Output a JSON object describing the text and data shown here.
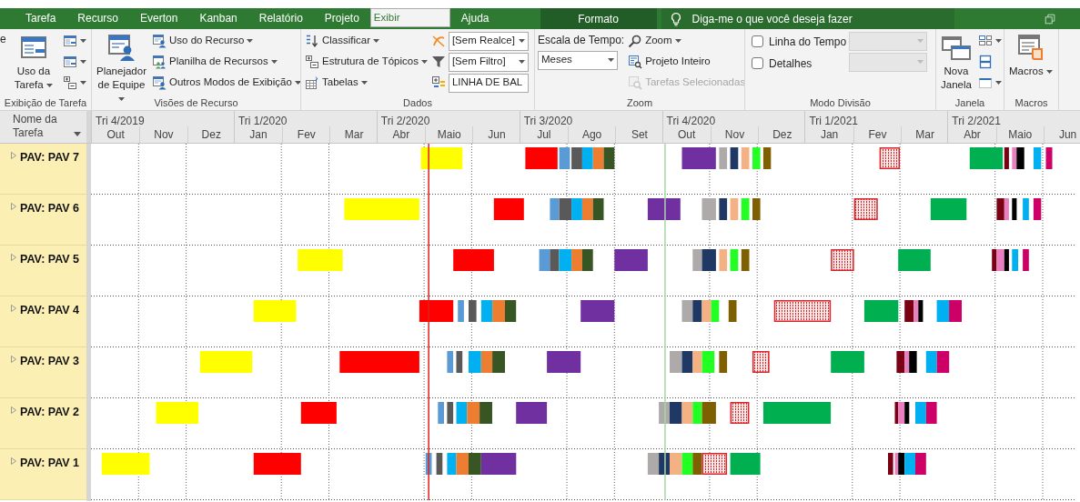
{
  "tabs": [
    {
      "label": "Tarefa",
      "selected": false
    },
    {
      "label": "Recurso",
      "selected": false
    },
    {
      "label": "Everton",
      "selected": false
    },
    {
      "label": "Kanban",
      "selected": false
    },
    {
      "label": "Relatório",
      "selected": false
    },
    {
      "label": "Projeto",
      "selected": false
    },
    {
      "label": "Exibir",
      "selected": true
    },
    {
      "label": "Ajuda",
      "selected": false
    }
  ],
  "context_tab": {
    "label": "Formato"
  },
  "search": {
    "placeholder": "Diga-me o que você deseja fazer"
  },
  "ribbon": {
    "groups": [
      {
        "label": "Exibição de Tarefa",
        "columns": [
          [
            {
              "kind": "cut",
              "label": "e"
            }
          ],
          [
            {
              "kind": "large",
              "label": "Uso da Tarefa",
              "caret": true
            }
          ],
          [
            {
              "kind": "icon",
              "caret": true
            },
            {
              "kind": "icon",
              "caret": true
            },
            {
              "kind": "icon",
              "caret": true
            }
          ]
        ]
      },
      {
        "label": "Visões de Recurso",
        "columns": [
          [
            {
              "kind": "large",
              "label": "Planejador de Equipe",
              "caret": true
            }
          ],
          [
            {
              "kind": "small",
              "label": "Uso do Recurso",
              "caret": true,
              "disabled": false
            },
            {
              "kind": "small",
              "label": "Planilha de Recursos",
              "caret": true,
              "disabled": false
            },
            {
              "kind": "small",
              "label": "Outros Modos de Exibição",
              "caret": true,
              "disabled": false
            }
          ]
        ]
      },
      {
        "label": "Dados",
        "columns": [
          [
            {
              "kind": "small",
              "label": "Classificar",
              "caret": true,
              "disabled": false
            },
            {
              "kind": "small",
              "label": "Estrutura de Tópicos",
              "caret": true,
              "disabled": false
            },
            {
              "kind": "small",
              "label": "Tabelas",
              "caret": true,
              "disabled": false
            }
          ],
          [
            {
              "kind": "icon-select",
              "value": "[Sem Realce]",
              "disabled": false
            },
            {
              "kind": "icon-select",
              "value": "[Sem Filtro]",
              "disabled": false
            },
            {
              "kind": "icon-select",
              "value": "LINHA DE BAL",
              "disabled": false
            }
          ]
        ]
      },
      {
        "label": "Zoom",
        "columns": [
          [
            {
              "kind": "caption",
              "label": "Escala de Tempo:"
            },
            {
              "kind": "select",
              "value": "Meses",
              "disabled": false
            }
          ],
          [
            {
              "kind": "small",
              "label": "Zoom",
              "caret": true,
              "disabled": false
            },
            {
              "kind": "small",
              "label": "Projeto Inteiro",
              "caret": false,
              "disabled": false
            },
            {
              "kind": "small",
              "label": "Tarefas Selecionadas",
              "caret": false,
              "disabled": true
            }
          ]
        ]
      },
      {
        "label": "Modo Divisão",
        "columns": [
          [
            {
              "kind": "checkbox",
              "label": "Linha do Tempo",
              "checked": false
            },
            {
              "kind": "checkbox",
              "label": "Detalhes",
              "checked": false
            }
          ],
          [
            {
              "kind": "select",
              "disabled": true
            },
            {
              "kind": "select",
              "disabled": true
            }
          ]
        ]
      },
      {
        "label": "Janela",
        "columns": [
          [
            {
              "kind": "large",
              "label": "Nova Janela",
              "caret": false
            }
          ],
          [
            {
              "kind": "icon",
              "caret": true
            },
            {
              "kind": "icon",
              "caret": false
            },
            {
              "kind": "icon",
              "caret": true
            }
          ]
        ]
      },
      {
        "label": "Macros",
        "columns": [
          [
            {
              "kind": "large",
              "label": "Macros",
              "caret": true
            }
          ]
        ]
      }
    ]
  },
  "task_column": {
    "header": "Nome da Tarefa"
  },
  "timescale": {
    "quarters": [
      {
        "label": "Tri 4/2019",
        "months": [
          "Out",
          "Nov",
          "Dez"
        ]
      },
      {
        "label": "Tri 1/2020",
        "months": [
          "Jan",
          "Fev",
          "Mar"
        ]
      },
      {
        "label": "Tri 2/2020",
        "months": [
          "Abr",
          "Maio",
          "Jun"
        ]
      },
      {
        "label": "Tri 3/2020",
        "months": [
          "Jul",
          "Ago",
          "Set"
        ]
      },
      {
        "label": "Tri 4/2020",
        "months": [
          "Out",
          "Nov",
          "Dez"
        ]
      },
      {
        "label": "Tri 1/2021",
        "months": [
          "Jan",
          "Fev",
          "Mar"
        ]
      },
      {
        "label": "Tri 2/2021",
        "months": [
          "Abr",
          "Maio",
          "Jun"
        ]
      }
    ]
  },
  "date_lines": [
    {
      "color": "#e0201c"
    },
    {
      "color": "#a8d4a8"
    }
  ],
  "tasks": [
    {
      "name": "PAV: PAV 7",
      "expanded": false,
      "bars": [
        {
          "color": "#ffff00",
          "kind": "solid"
        },
        {
          "color": "#ff0000",
          "kind": "solid"
        },
        {
          "color": "#5b9bd5",
          "kind": "solid"
        },
        {
          "color": "#595959",
          "kind": "solid"
        },
        {
          "color": "#00b0f0",
          "kind": "solid"
        },
        {
          "color": "#ed7d31",
          "kind": "solid"
        },
        {
          "color": "#375623",
          "kind": "solid"
        },
        {
          "color": "#7030a0",
          "kind": "solid"
        },
        {
          "color": "#aeaaaa",
          "kind": "solid"
        },
        {
          "color": "#203864",
          "kind": "solid"
        },
        {
          "color": "#f4b183",
          "kind": "solid"
        },
        {
          "color": "#22ff22",
          "kind": "solid"
        },
        {
          "color": "#7f6000",
          "kind": "solid"
        },
        {
          "color": "#d9262c",
          "kind": "hatched"
        },
        {
          "color": "#00b050",
          "kind": "solid"
        },
        {
          "color": "#7a0013",
          "kind": "solid"
        },
        {
          "color": "#e880c0",
          "kind": "solid"
        },
        {
          "color": "#000000",
          "kind": "solid"
        },
        {
          "color": "#00b0f0",
          "kind": "solid"
        },
        {
          "color": "#cc0066",
          "kind": "solid"
        }
      ]
    },
    {
      "name": "PAV: PAV 6",
      "expanded": false,
      "bars": [
        {
          "color": "#ffff00",
          "kind": "solid"
        },
        {
          "color": "#ff0000",
          "kind": "solid"
        },
        {
          "color": "#5b9bd5",
          "kind": "solid"
        },
        {
          "color": "#595959",
          "kind": "solid"
        },
        {
          "color": "#00b0f0",
          "kind": "solid"
        },
        {
          "color": "#ed7d31",
          "kind": "solid"
        },
        {
          "color": "#375623",
          "kind": "solid"
        },
        {
          "color": "#7030a0",
          "kind": "solid"
        },
        {
          "color": "#aeaaaa",
          "kind": "solid"
        },
        {
          "color": "#203864",
          "kind": "solid"
        },
        {
          "color": "#f4b183",
          "kind": "solid"
        },
        {
          "color": "#22ff22",
          "kind": "solid"
        },
        {
          "color": "#7f6000",
          "kind": "solid"
        },
        {
          "color": "#d9262c",
          "kind": "hatched"
        },
        {
          "color": "#00b050",
          "kind": "solid"
        },
        {
          "color": "#7a0013",
          "kind": "solid"
        },
        {
          "color": "#e880c0",
          "kind": "solid"
        },
        {
          "color": "#000000",
          "kind": "solid"
        },
        {
          "color": "#00b0f0",
          "kind": "solid"
        },
        {
          "color": "#cc0066",
          "kind": "solid"
        }
      ]
    },
    {
      "name": "PAV: PAV 5",
      "expanded": false,
      "bars": [
        {
          "color": "#ffff00",
          "kind": "solid"
        },
        {
          "color": "#ff0000",
          "kind": "solid"
        },
        {
          "color": "#5b9bd5",
          "kind": "solid"
        },
        {
          "color": "#595959",
          "kind": "solid"
        },
        {
          "color": "#00b0f0",
          "kind": "solid"
        },
        {
          "color": "#ed7d31",
          "kind": "solid"
        },
        {
          "color": "#375623",
          "kind": "solid"
        },
        {
          "color": "#7030a0",
          "kind": "solid"
        },
        {
          "color": "#aeaaaa",
          "kind": "solid"
        },
        {
          "color": "#203864",
          "kind": "solid"
        },
        {
          "color": "#f4b183",
          "kind": "solid"
        },
        {
          "color": "#22ff22",
          "kind": "solid"
        },
        {
          "color": "#7f6000",
          "kind": "solid"
        },
        {
          "color": "#d9262c",
          "kind": "hatched"
        },
        {
          "color": "#00b050",
          "kind": "solid"
        },
        {
          "color": "#7a0013",
          "kind": "solid"
        },
        {
          "color": "#e880c0",
          "kind": "solid"
        },
        {
          "color": "#000000",
          "kind": "solid"
        },
        {
          "color": "#00b0f0",
          "kind": "solid"
        },
        {
          "color": "#cc0066",
          "kind": "solid"
        }
      ]
    },
    {
      "name": "PAV: PAV 4",
      "expanded": false,
      "bars": [
        {
          "color": "#ffff00",
          "kind": "solid"
        },
        {
          "color": "#ff0000",
          "kind": "solid"
        },
        {
          "color": "#5b9bd5",
          "kind": "solid"
        },
        {
          "color": "#595959",
          "kind": "solid"
        },
        {
          "color": "#00b0f0",
          "kind": "solid"
        },
        {
          "color": "#ed7d31",
          "kind": "solid"
        },
        {
          "color": "#375623",
          "kind": "solid"
        },
        {
          "color": "#7030a0",
          "kind": "solid"
        },
        {
          "color": "#aeaaaa",
          "kind": "solid"
        },
        {
          "color": "#203864",
          "kind": "solid"
        },
        {
          "color": "#f4b183",
          "kind": "solid"
        },
        {
          "color": "#22ff22",
          "kind": "solid"
        },
        {
          "color": "#7f6000",
          "kind": "solid"
        },
        {
          "color": "#d9262c",
          "kind": "hatched"
        },
        {
          "color": "#00b050",
          "kind": "solid"
        },
        {
          "color": "#7a0013",
          "kind": "solid"
        },
        {
          "color": "#e880c0",
          "kind": "solid"
        },
        {
          "color": "#000000",
          "kind": "solid"
        },
        {
          "color": "#00b0f0",
          "kind": "solid"
        },
        {
          "color": "#cc0066",
          "kind": "solid"
        }
      ]
    },
    {
      "name": "PAV: PAV 3",
      "expanded": false,
      "bars": [
        {
          "color": "#ffff00",
          "kind": "solid"
        },
        {
          "color": "#ff0000",
          "kind": "solid"
        },
        {
          "color": "#5b9bd5",
          "kind": "solid"
        },
        {
          "color": "#595959",
          "kind": "solid"
        },
        {
          "color": "#00b0f0",
          "kind": "solid"
        },
        {
          "color": "#ed7d31",
          "kind": "solid"
        },
        {
          "color": "#375623",
          "kind": "solid"
        },
        {
          "color": "#7030a0",
          "kind": "solid"
        },
        {
          "color": "#aeaaaa",
          "kind": "solid"
        },
        {
          "color": "#203864",
          "kind": "solid"
        },
        {
          "color": "#f4b183",
          "kind": "solid"
        },
        {
          "color": "#22ff22",
          "kind": "solid"
        },
        {
          "color": "#7f6000",
          "kind": "solid"
        },
        {
          "color": "#d9262c",
          "kind": "hatched"
        },
        {
          "color": "#00b050",
          "kind": "solid"
        },
        {
          "color": "#7a0013",
          "kind": "solid"
        },
        {
          "color": "#e880c0",
          "kind": "solid"
        },
        {
          "color": "#000000",
          "kind": "solid"
        },
        {
          "color": "#00b0f0",
          "kind": "solid"
        },
        {
          "color": "#cc0066",
          "kind": "solid"
        }
      ]
    },
    {
      "name": "PAV: PAV 2",
      "expanded": false,
      "bars": [
        {
          "color": "#ffff00",
          "kind": "solid"
        },
        {
          "color": "#ff0000",
          "kind": "solid"
        },
        {
          "color": "#5b9bd5",
          "kind": "solid"
        },
        {
          "color": "#595959",
          "kind": "solid"
        },
        {
          "color": "#00b0f0",
          "kind": "solid"
        },
        {
          "color": "#ed7d31",
          "kind": "solid"
        },
        {
          "color": "#375623",
          "kind": "solid"
        },
        {
          "color": "#7030a0",
          "kind": "solid"
        },
        {
          "color": "#aeaaaa",
          "kind": "solid"
        },
        {
          "color": "#203864",
          "kind": "solid"
        },
        {
          "color": "#f4b183",
          "kind": "solid"
        },
        {
          "color": "#22ff22",
          "kind": "solid"
        },
        {
          "color": "#7f6000",
          "kind": "solid"
        },
        {
          "color": "#d9262c",
          "kind": "hatched"
        },
        {
          "color": "#00b050",
          "kind": "solid"
        },
        {
          "color": "#7a0013",
          "kind": "solid"
        },
        {
          "color": "#e880c0",
          "kind": "solid"
        },
        {
          "color": "#000000",
          "kind": "solid"
        },
        {
          "color": "#00b0f0",
          "kind": "solid"
        },
        {
          "color": "#cc0066",
          "kind": "solid"
        }
      ]
    },
    {
      "name": "PAV: PAV 1",
      "expanded": false,
      "bars": [
        {
          "color": "#ffff00",
          "kind": "solid"
        },
        {
          "color": "#ff0000",
          "kind": "solid"
        },
        {
          "color": "#5b9bd5",
          "kind": "solid"
        },
        {
          "color": "#595959",
          "kind": "solid"
        },
        {
          "color": "#00b0f0",
          "kind": "solid"
        },
        {
          "color": "#ed7d31",
          "kind": "solid"
        },
        {
          "color": "#375623",
          "kind": "solid"
        },
        {
          "color": "#7030a0",
          "kind": "solid"
        },
        {
          "color": "#aeaaaa",
          "kind": "solid"
        },
        {
          "color": "#203864",
          "kind": "solid"
        },
        {
          "color": "#f4b183",
          "kind": "solid"
        },
        {
          "color": "#22ff22",
          "kind": "solid"
        },
        {
          "color": "#7f6000",
          "kind": "solid"
        },
        {
          "color": "#d9262c",
          "kind": "hatched"
        },
        {
          "color": "#00b050",
          "kind": "solid"
        },
        {
          "color": "#7a0013",
          "kind": "solid"
        },
        {
          "color": "#e880c0",
          "kind": "solid"
        },
        {
          "color": "#000000",
          "kind": "solid"
        },
        {
          "color": "#00b0f0",
          "kind": "solid"
        },
        {
          "color": "#cc0066",
          "kind": "solid"
        }
      ]
    }
  ]
}
